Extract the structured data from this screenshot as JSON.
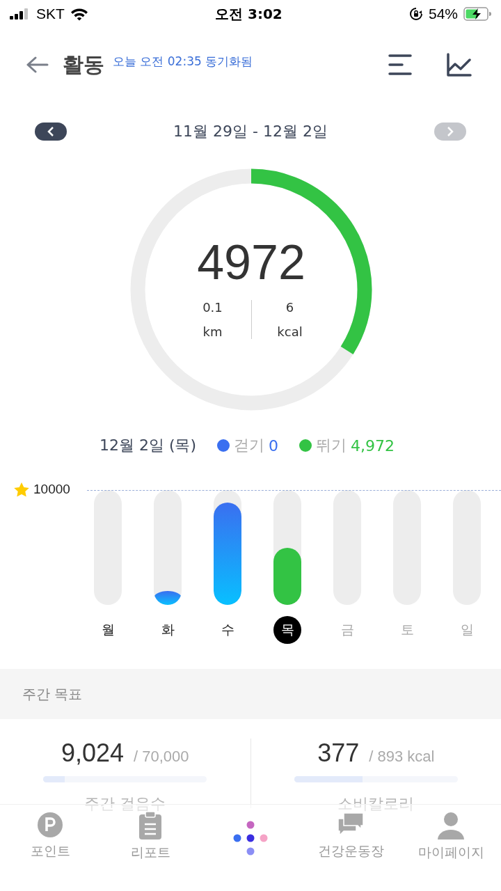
{
  "status_bar": {
    "carrier": "SKT",
    "time": "오전 3:02",
    "battery": "54%"
  },
  "header": {
    "title": "활동",
    "sync": "오늘 오전 02:35 동기화됨"
  },
  "date_nav": {
    "range": "11월 29일 - 12월 2일",
    "prev_disabled": false,
    "next_disabled": true
  },
  "ring": {
    "steps": "4972",
    "level": 0.34,
    "distance": "0.1",
    "distance_unit": "km",
    "calories": "6",
    "calories_unit": "kcal"
  },
  "legend": {
    "date": "12월 2일 (목)",
    "items": [
      {
        "label": "걷기",
        "value": "0",
        "color": "#3a6ff0"
      },
      {
        "label": "뛰기",
        "value": "4,972",
        "color": "#33c344"
      }
    ]
  },
  "week_chart": {
    "goal": "10000",
    "days": [
      {
        "label": "월",
        "selected": false,
        "future": false
      },
      {
        "label": "화",
        "level": 0.03,
        "selected": false,
        "future": false
      },
      {
        "label": "수",
        "level": 0.89,
        "selected": false,
        "future": false
      },
      {
        "label": "목",
        "level": 0.5,
        "selected": true,
        "future": false
      },
      {
        "label": "금",
        "selected": false,
        "future": true
      },
      {
        "label": "토",
        "selected": false,
        "future": true
      },
      {
        "label": "일",
        "selected": false,
        "future": true
      }
    ]
  },
  "weekly_goal": {
    "title": "주간 목표",
    "items": [
      {
        "value": "9,024",
        "target": "/ 70,000",
        "label": "주간 걸음수",
        "level": 0.13
      },
      {
        "value": "377",
        "target": "/ 893 kcal",
        "label": "소비칼로리",
        "level": 0.42
      }
    ]
  },
  "tab_bar": [
    {
      "kind": "points",
      "label": "포인트"
    },
    {
      "kind": "report",
      "label": "리포트"
    },
    {
      "kind": "home"
    },
    {
      "kind": "community",
      "label": "건강운동장"
    },
    {
      "kind": "profile",
      "label": "마이페이지"
    }
  ]
}
